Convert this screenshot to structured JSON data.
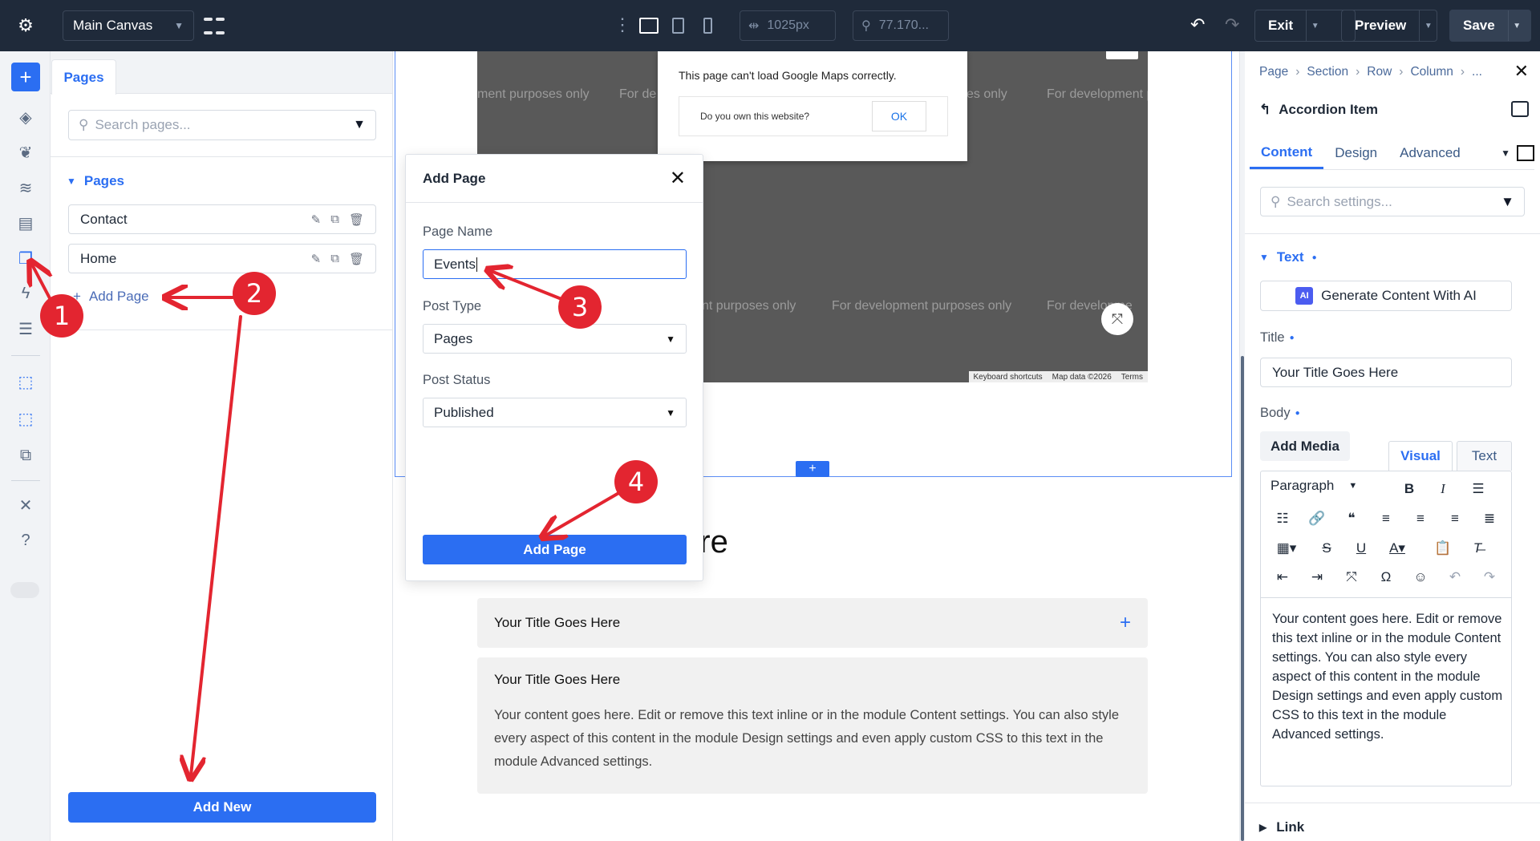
{
  "topbar": {
    "canvas_select": "Main Canvas",
    "width_value": "1025px",
    "zoom_value": "77.170...",
    "exit_label": "Exit",
    "preview_label": "Preview",
    "save_label": "Save"
  },
  "pages_panel": {
    "tab_label": "Pages",
    "search_placeholder": "Search pages...",
    "section_title": "Pages",
    "pages": [
      {
        "name": "Contact"
      },
      {
        "name": "Home"
      }
    ],
    "add_page_label": "Add Page",
    "add_new_label": "Add New"
  },
  "canvas": {
    "map_warning": "This page can't load Google Maps correctly.",
    "map_question": "Do you own this website?",
    "map_ok": "OK",
    "map_dev_text": "For development purposes only",
    "map_dev_text_cut1": "ment purposes only",
    "map_dev_text_cut2": "For de",
    "map_dev_text_cut3": "For development p",
    "map_dev_text_cut4": "nt purposes only",
    "map_dev_text_cut5": "For developme",
    "map_dev_text_cut6": "es only",
    "map_footer": [
      "Keyboard shortcuts",
      "Map data ©2026",
      "Terms"
    ],
    "heading_visible": "s Here",
    "accordion_closed_title": "Your Title Goes Here",
    "accordion_open_title": "Your Title Goes Here",
    "accordion_open_body": "Your content goes here. Edit or remove this text inline or in the module Content settings. You can also style every aspect of this content in the module Design settings and even apply custom CSS to this text in the module Advanced settings."
  },
  "modal": {
    "title": "Add Page",
    "page_name_label": "Page Name",
    "page_name_value": "Events",
    "post_type_label": "Post Type",
    "post_type_value": "Pages",
    "post_status_label": "Post Status",
    "post_status_value": "Published",
    "submit_label": "Add Page"
  },
  "settings": {
    "breadcrumb": [
      "Page",
      "Section",
      "Row",
      "Column",
      "..."
    ],
    "module_title": "Accordion Item",
    "tabs": [
      "Content",
      "Design",
      "Advanced"
    ],
    "search_placeholder": "Search settings...",
    "text_section": "Text",
    "ai_button": "Generate Content With AI",
    "ai_badge": "AI",
    "title_label": "Title",
    "title_value": "Your Title Goes Here",
    "body_label": "Body",
    "add_media": "Add Media",
    "visual_tab": "Visual",
    "text_tab": "Text",
    "paragraph_select": "Paragraph",
    "body_text": "Your content goes here. Edit or remove this text inline or in the module Content settings. You can also style every aspect of this content in the module Design settings and even apply custom CSS to this text in the module Advanced settings.",
    "link_section": "Link"
  },
  "annotations": [
    "1",
    "2",
    "3",
    "4"
  ],
  "colors": {
    "accent": "#2b6ef2",
    "topbar": "#1f2a3a",
    "annotation": "#e32530"
  }
}
